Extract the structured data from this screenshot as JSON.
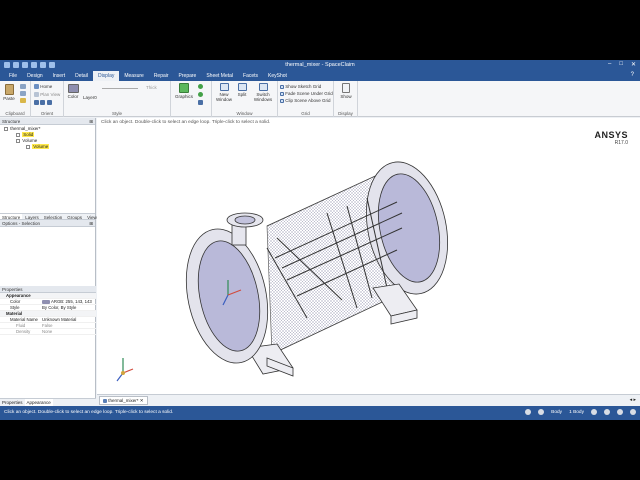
{
  "window": {
    "title": "thermal_mixer - SpaceClaim"
  },
  "menu": {
    "tabs": [
      "File",
      "Design",
      "Insert",
      "Detail",
      "Display",
      "Measure",
      "Repair",
      "Prepare",
      "Sheet Metal",
      "Facets",
      "KeyShot"
    ],
    "active": "Display"
  },
  "ribbon": {
    "clipboard": {
      "paste": "Paste",
      "label": "Clipboard"
    },
    "orient": {
      "home": "Home",
      "plan_view": "Plan View",
      "label": "Orient"
    },
    "style": {
      "color": "Color",
      "layer": "Layer0",
      "thick": "Thick",
      "label": "Style"
    },
    "graphics": {
      "label": "Graphics"
    },
    "window": {
      "new_window": "New Window",
      "split": "Split",
      "switch": "Switch Windows",
      "label": "Window"
    },
    "grid": {
      "options": [
        "Show Sketch Grid",
        "Fade Scene Under Grid",
        "Clip Scene Above Grid"
      ],
      "label": "Grid"
    },
    "display": {
      "show": "Show",
      "label": "Display"
    }
  },
  "structure": {
    "header": "Structure",
    "tree": [
      {
        "label": "thermal_mixer*",
        "indent": 0
      },
      {
        "label": "Solid",
        "indent": 1,
        "highlight": true
      },
      {
        "label": "Volume",
        "indent": 1
      },
      {
        "label": "Volume",
        "indent": 2,
        "highlight": true
      }
    ],
    "tabs": [
      "Structure",
      "Layers",
      "Selection",
      "Groups",
      "Views"
    ]
  },
  "options": {
    "header": "Options - Selection"
  },
  "properties": {
    "header": "Properties",
    "rows": [
      {
        "k": "Appearance",
        "v": "",
        "type": "sec"
      },
      {
        "k": "Color",
        "v": "ARGB: 255, 143, 143",
        "type": "row"
      },
      {
        "k": "Style",
        "v": "By Color, By Style",
        "type": "row"
      },
      {
        "k": "Material",
        "v": "",
        "type": "sec"
      },
      {
        "k": "Material Name",
        "v": "Unknown Material",
        "type": "row"
      },
      {
        "k": "Fluid",
        "v": "False",
        "type": "dim"
      },
      {
        "k": "Density",
        "v": "None",
        "type": "dim"
      }
    ],
    "tabs": [
      "Properties",
      "Appearance"
    ]
  },
  "viewport": {
    "hint": "Click an object. Double-click to select an edge loop. Triple-click to select a solid.",
    "logo": "ANSYS",
    "version": "R17.0"
  },
  "document_tab": "thermal_mixer*",
  "status": {
    "message": "Click an object. Double-click to select an edge loop. Triple-click to select a solid.",
    "mode": "Body",
    "count": "1 Body"
  },
  "colors": {
    "accent": "#2b5797",
    "highlight": "#ffe94a"
  }
}
